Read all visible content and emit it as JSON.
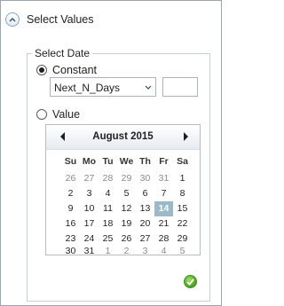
{
  "panel": {
    "title": "Select Values",
    "collapse_icon": "chevron-up-icon"
  },
  "group": {
    "legend": "Select Date"
  },
  "constant_option": {
    "label": "Constant",
    "selected": true,
    "dropdown_value": "Next_N_Days",
    "number_value": ""
  },
  "value_option": {
    "label": "Value",
    "selected": false
  },
  "calendar": {
    "month_title": "August 2015",
    "weekdays": [
      "Su",
      "Mo",
      "Tu",
      "We",
      "Th",
      "Fr",
      "Sa"
    ],
    "weeks": [
      [
        {
          "d": "26",
          "o": true
        },
        {
          "d": "27",
          "o": true
        },
        {
          "d": "28",
          "o": true
        },
        {
          "d": "29",
          "o": true
        },
        {
          "d": "30",
          "o": true
        },
        {
          "d": "31",
          "o": true
        },
        {
          "d": "1",
          "o": false
        }
      ],
      [
        {
          "d": "2",
          "o": false
        },
        {
          "d": "3",
          "o": false
        },
        {
          "d": "4",
          "o": false
        },
        {
          "d": "5",
          "o": false
        },
        {
          "d": "6",
          "o": false
        },
        {
          "d": "7",
          "o": false
        },
        {
          "d": "8",
          "o": false
        }
      ],
      [
        {
          "d": "9",
          "o": false
        },
        {
          "d": "10",
          "o": false
        },
        {
          "d": "11",
          "o": false
        },
        {
          "d": "12",
          "o": false
        },
        {
          "d": "13",
          "o": false
        },
        {
          "d": "14",
          "o": false,
          "today": true
        },
        {
          "d": "15",
          "o": false
        }
      ],
      [
        {
          "d": "16",
          "o": false
        },
        {
          "d": "17",
          "o": false
        },
        {
          "d": "18",
          "o": false
        },
        {
          "d": "19",
          "o": false
        },
        {
          "d": "20",
          "o": false
        },
        {
          "d": "21",
          "o": false
        },
        {
          "d": "22",
          "o": false
        }
      ],
      [
        {
          "d": "23",
          "o": false
        },
        {
          "d": "24",
          "o": false
        },
        {
          "d": "25",
          "o": false
        },
        {
          "d": "26",
          "o": false
        },
        {
          "d": "27",
          "o": false
        },
        {
          "d": "28",
          "o": false
        },
        {
          "d": "29",
          "o": false
        }
      ],
      [
        {
          "d": "30",
          "o": false
        },
        {
          "d": "31",
          "o": false
        },
        {
          "d": "1",
          "o": true
        },
        {
          "d": "2",
          "o": true
        },
        {
          "d": "3",
          "o": true
        },
        {
          "d": "4",
          "o": true
        },
        {
          "d": "5",
          "o": true
        }
      ]
    ],
    "highlight_color": "#9bb9c8"
  },
  "confirm": {
    "icon": "check-icon",
    "color": "#4c9f1f"
  }
}
